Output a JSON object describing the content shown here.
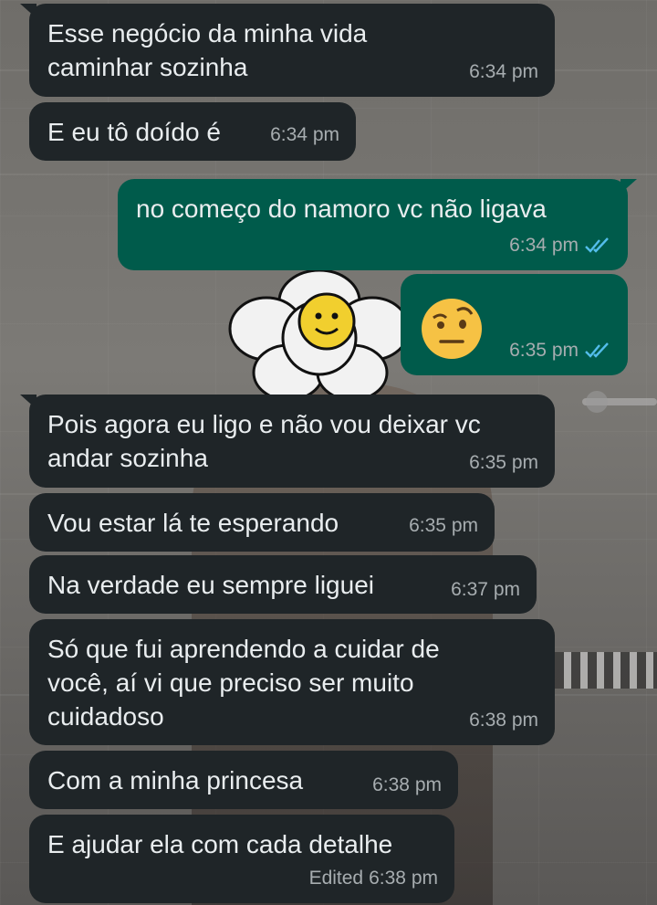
{
  "colors": {
    "incoming_bubble": "#1f2528",
    "outgoing_bubble": "#005b4b",
    "text": "#e9edef",
    "timestamp": "#a7adb0",
    "read_check": "#53bdeb"
  },
  "messages": [
    {
      "direction": "in",
      "text": "Esse negócio da minha vida caminhar sozinha",
      "time": "6:34 pm"
    },
    {
      "direction": "in",
      "text": "E eu tô doído é",
      "time": "6:34 pm"
    },
    {
      "direction": "out",
      "text": "no começo do namoro vc não ligava",
      "time": "6:34 pm",
      "status": "read"
    },
    {
      "direction": "out",
      "emoji": "face-with-raised-eyebrow",
      "time": "6:35 pm",
      "status": "read"
    },
    {
      "direction": "in",
      "text": "Pois agora eu ligo e não vou deixar vc andar sozinha",
      "time": "6:35 pm"
    },
    {
      "direction": "in",
      "text": "Vou estar lá te esperando",
      "time": "6:35 pm"
    },
    {
      "direction": "in",
      "text": "Na verdade eu sempre liguei",
      "time": "6:37 pm"
    },
    {
      "direction": "in",
      "text": "Só que fui aprendendo a cuidar de você, aí vi que preciso ser muito cuidadoso",
      "time": "6:38 pm"
    },
    {
      "direction": "in",
      "text": "Com a minha princesa",
      "time": "6:38 pm"
    },
    {
      "direction": "in",
      "text": "E ajudar ela com cada detalhe",
      "time": "6:38 pm",
      "edited_label": "Edited"
    }
  ]
}
